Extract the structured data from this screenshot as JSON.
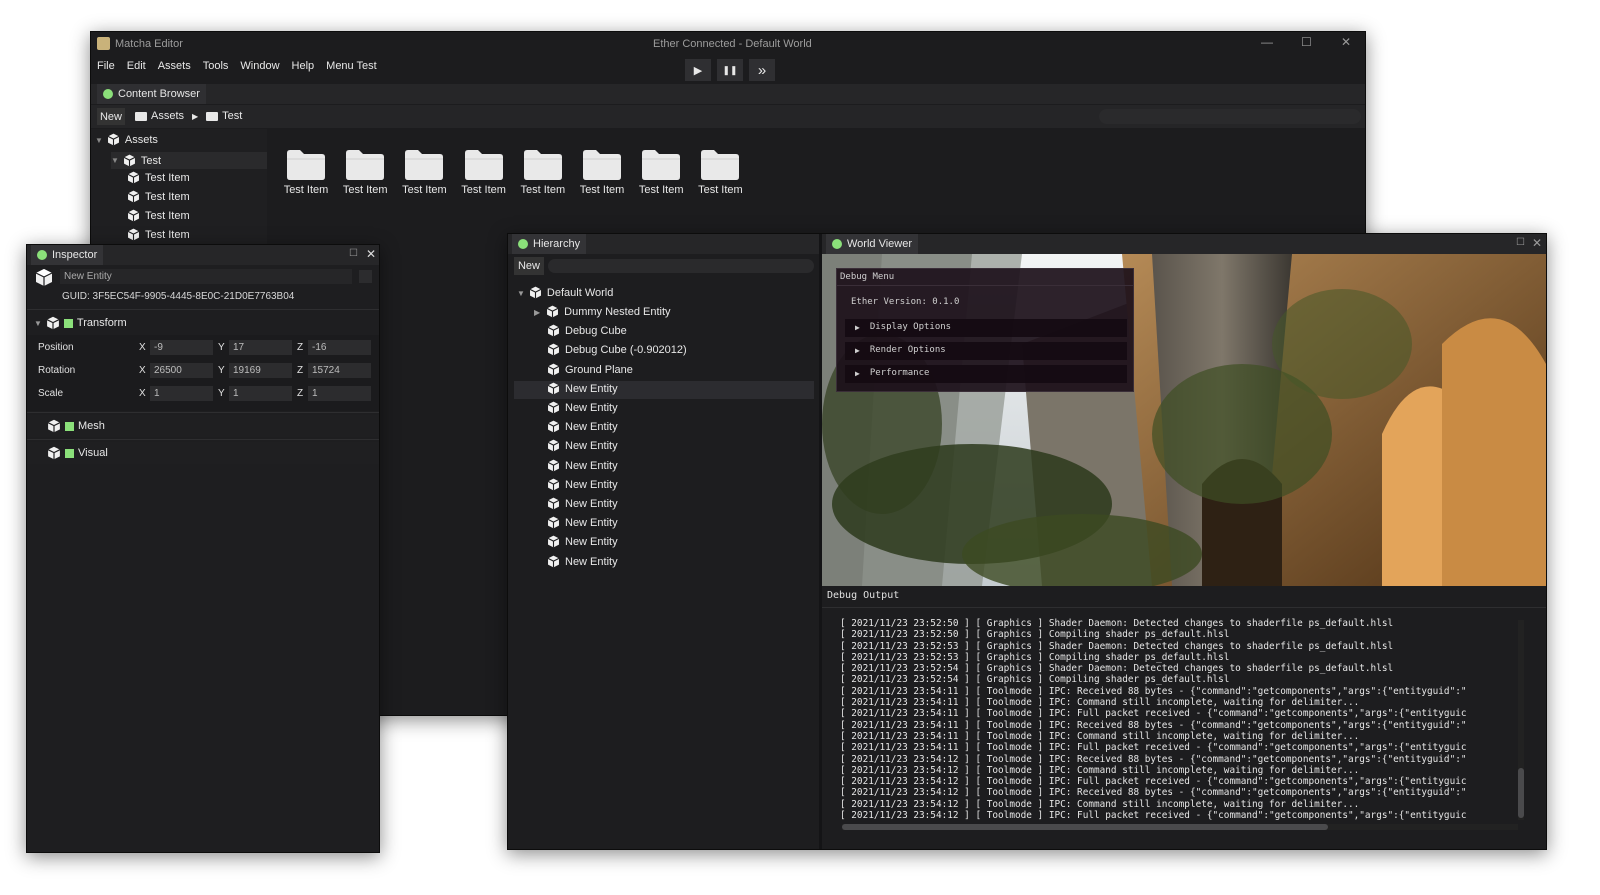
{
  "main_window": {
    "app_name": "Matcha Editor",
    "title": "Ether Connected - Default World",
    "menu": [
      "File",
      "Edit",
      "Assets",
      "Tools",
      "Window",
      "Help",
      "Menu Test"
    ],
    "playback": {
      "play": "▶",
      "pause": "❚❚",
      "step": "»"
    }
  },
  "content_browser": {
    "tab_label": "Content Browser",
    "new_label": "New",
    "breadcrumb": [
      "Assets",
      "Test"
    ],
    "tree": [
      {
        "label": "Assets",
        "level": 0
      },
      {
        "label": "Test",
        "level": 1
      },
      {
        "label": "Test Item",
        "level": 2
      },
      {
        "label": "Test Item",
        "level": 2
      },
      {
        "label": "Test Item",
        "level": 2
      },
      {
        "label": "Test Item",
        "level": 2
      }
    ],
    "items": [
      "Test Item",
      "Test Item",
      "Test Item",
      "Test Item",
      "Test Item",
      "Test Item",
      "Test Item",
      "Test Item"
    ]
  },
  "inspector": {
    "tab_label": "Inspector",
    "entity_name": "New Entity",
    "guid": "GUID: 3F5EC54F-9905-4445-8E0C-21D0E7763B04",
    "components": [
      "Transform",
      "Mesh",
      "Visual"
    ],
    "transform": {
      "axis_x": "X",
      "axis_y": "Y",
      "axis_z": "Z",
      "rows": [
        {
          "label": "Position",
          "x": "-9",
          "y": "17",
          "z": "-16"
        },
        {
          "label": "Rotation",
          "x": "26500",
          "y": "19169",
          "z": "15724"
        },
        {
          "label": "Scale",
          "x": "1",
          "y": "1",
          "z": "1"
        }
      ]
    }
  },
  "hierarchy": {
    "tab_label": "Hierarchy",
    "new_label": "New",
    "root": "Default World",
    "entities": [
      "Dummy Nested Entity",
      "Debug Cube",
      "Debug Cube (-0.902012)",
      "Ground Plane",
      "New Entity",
      "New Entity",
      "New Entity",
      "New Entity",
      "New Entity",
      "New Entity",
      "New Entity",
      "New Entity",
      "New Entity",
      "New Entity"
    ],
    "selected_index": 4
  },
  "world_viewer": {
    "tab_label": "World Viewer",
    "debug_menu": {
      "title": "Debug Menu",
      "version": "Ether Version: 0.1.0",
      "options": [
        "Display Options",
        "Render Options",
        "Performance"
      ]
    },
    "debug_output_label": "Debug Output",
    "log_lines": [
      "[ 2021/11/23 23:52:50 ] [ Graphics ] Shader Daemon: Detected changes to shaderfile ps_default.hlsl",
      "[ 2021/11/23 23:52:50 ] [ Graphics ] Compiling shader ps_default.hlsl",
      "[ 2021/11/23 23:52:53 ] [ Graphics ] Shader Daemon: Detected changes to shaderfile ps_default.hlsl",
      "[ 2021/11/23 23:52:53 ] [ Graphics ] Compiling shader ps_default.hlsl",
      "[ 2021/11/23 23:52:54 ] [ Graphics ] Shader Daemon: Detected changes to shaderfile ps_default.hlsl",
      "[ 2021/11/23 23:52:54 ] [ Graphics ] Compiling shader ps_default.hlsl",
      "[ 2021/11/23 23:54:11 ] [ Toolmode ] IPC: Received 88 bytes - {\"command\":\"getcomponents\",\"args\":{\"entityguid\":\"",
      "[ 2021/11/23 23:54:11 ] [ Toolmode ] IPC: Command still incomplete, waiting for delimiter...",
      "[ 2021/11/23 23:54:11 ] [ Toolmode ] IPC: Full packet received - {\"command\":\"getcomponents\",\"args\":{\"entityguic",
      "[ 2021/11/23 23:54:11 ] [ Toolmode ] IPC: Received 88 bytes - {\"command\":\"getcomponents\",\"args\":{\"entityguid\":\"",
      "[ 2021/11/23 23:54:11 ] [ Toolmode ] IPC: Command still incomplete, waiting for delimiter...",
      "[ 2021/11/23 23:54:11 ] [ Toolmode ] IPC: Full packet received - {\"command\":\"getcomponents\",\"args\":{\"entityguic",
      "[ 2021/11/23 23:54:12 ] [ Toolmode ] IPC: Received 88 bytes - {\"command\":\"getcomponents\",\"args\":{\"entityguid\":\"",
      "[ 2021/11/23 23:54:12 ] [ Toolmode ] IPC: Command still incomplete, waiting for delimiter...",
      "[ 2021/11/23 23:54:12 ] [ Toolmode ] IPC: Full packet received - {\"command\":\"getcomponents\",\"args\":{\"entityguic",
      "[ 2021/11/23 23:54:12 ] [ Toolmode ] IPC: Received 88 bytes - {\"command\":\"getcomponents\",\"args\":{\"entityguid\":\"",
      "[ 2021/11/23 23:54:12 ] [ Toolmode ] IPC: Command still incomplete, waiting for delimiter...",
      "[ 2021/11/23 23:54:12 ] [ Toolmode ] IPC: Full packet received - {\"command\":\"getcomponents\",\"args\":{\"entityguic"
    ]
  },
  "colors": {
    "accent_green": "#8be07a",
    "panel_bg": "#1d1d1f",
    "header_bg": "#2a2a2c"
  }
}
